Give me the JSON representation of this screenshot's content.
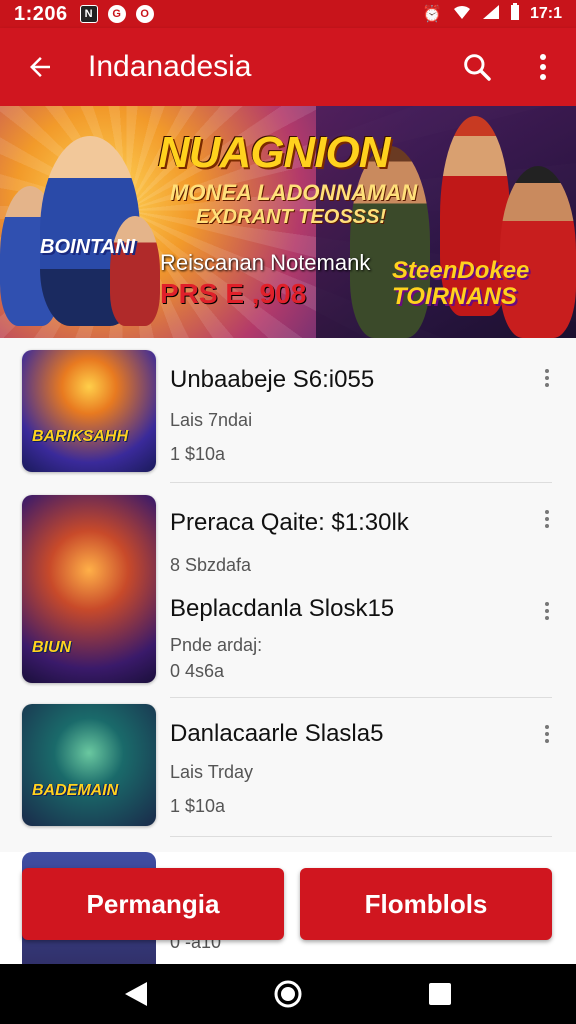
{
  "status_bar": {
    "time": "1:206",
    "notif_icons": [
      "N",
      "G",
      "O"
    ],
    "right_time": "17:1",
    "icons": [
      "alarm-icon",
      "wifi-icon",
      "signal-icon",
      "battery-icon"
    ]
  },
  "app_bar": {
    "title": "Indanadesia",
    "back_icon": "arrow-back-icon",
    "search_icon": "search-icon",
    "menu_icon": "more-vert-icon"
  },
  "banner": {
    "headline": "NUAGNION",
    "sub1": "MONEA LADONNAMAN",
    "sub2": "EXDRANT TEOSSS!",
    "badge": "BOINTANI",
    "sub3": "Reiscanan Notemank",
    "prize": "PRS E ,908",
    "right_title_1": "SteenDokee",
    "right_title_2": "TOIRNANS"
  },
  "list": {
    "items": [
      {
        "title": "Unbaabeje S6:i055",
        "subtitle": "Lais 7ndai",
        "meta": "1 $10a",
        "thumb_label": "BARIKSAHH"
      },
      {
        "title": "Preraca Qaite: $1:30lk",
        "subtitle": "8 Sbzdafa",
        "meta": "",
        "thumb_label": "BIUN"
      },
      {
        "title": "Beplacdanla Slosk15",
        "subtitle": "Pnde ardaj:",
        "meta": "0 4s6a",
        "thumb_label": ""
      },
      {
        "title": "Danlacaarle Slasla5",
        "subtitle": "Lais Trday",
        "meta": "1 $10a",
        "thumb_label": "BADEMAIN"
      }
    ],
    "peek_meta": "0 -a10"
  },
  "bottom_actions": {
    "left_label": "Permangia",
    "right_label": "Flomblols"
  },
  "nav_bar": {
    "back": "nav-back-icon",
    "home": "nav-home-icon",
    "recents": "nav-recents-icon"
  },
  "colors": {
    "primary": "#d0161f",
    "status_bar": "#c8141b"
  }
}
